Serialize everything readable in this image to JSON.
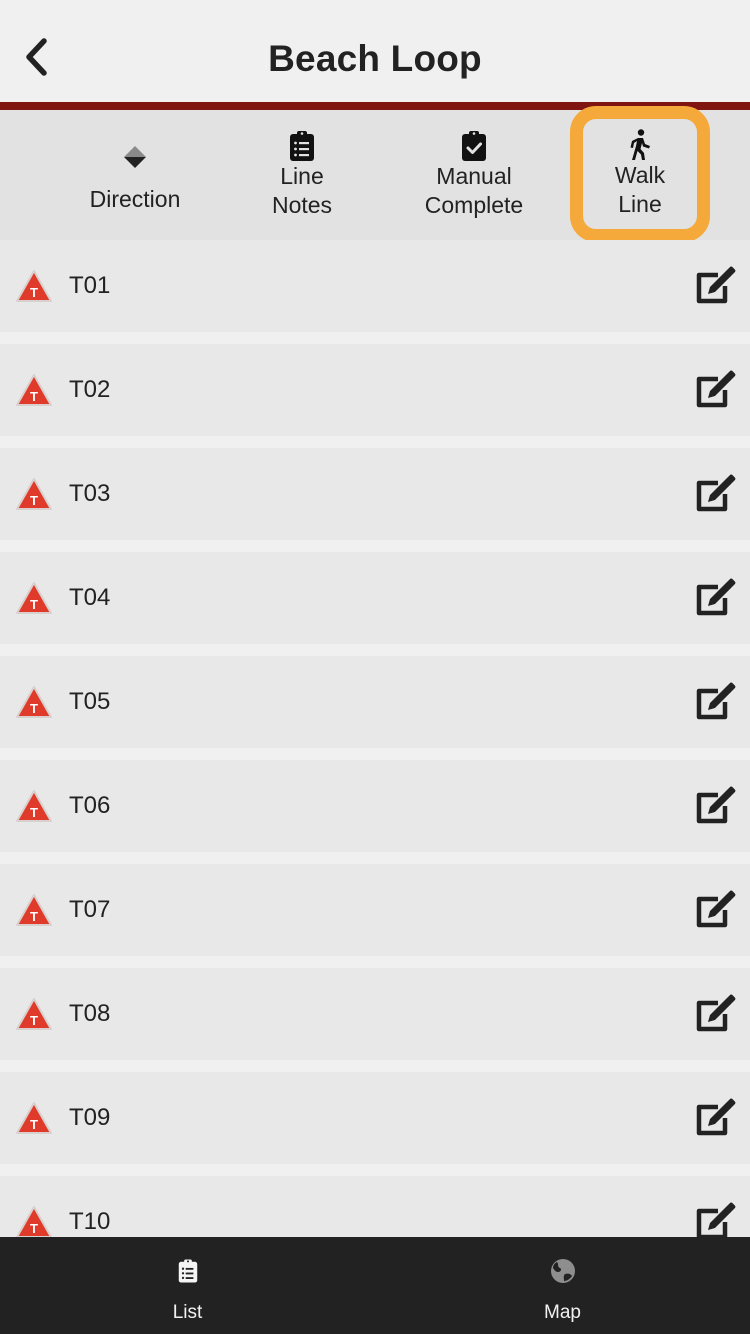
{
  "navbar": {
    "title": "Beach Loop",
    "back_icon": "chevron-left-icon"
  },
  "colors": {
    "accent_bar": "#7f1410",
    "highlight": "#f4a93a",
    "warning": "#e03a2a",
    "tabbar_bg": "#222222"
  },
  "toolbar": {
    "items": [
      {
        "id": "direction",
        "label": "Direction",
        "icon": "direction-diamond-icon"
      },
      {
        "id": "line-notes",
        "label": "Line\nNotes",
        "icon": "clipboard-list-icon"
      },
      {
        "id": "manual-complete",
        "label": "Manual\nComplete",
        "icon": "clipboard-check-icon"
      },
      {
        "id": "walk-line",
        "label": "Walk\nLine",
        "icon": "walking-person-icon",
        "highlighted": true
      }
    ]
  },
  "list": {
    "items": [
      {
        "name": "T01",
        "status_icon": "warning-triangle-icon",
        "action_icon": "edit-icon"
      },
      {
        "name": "T02",
        "status_icon": "warning-triangle-icon",
        "action_icon": "edit-icon"
      },
      {
        "name": "T03",
        "status_icon": "warning-triangle-icon",
        "action_icon": "edit-icon"
      },
      {
        "name": "T04",
        "status_icon": "warning-triangle-icon",
        "action_icon": "edit-icon"
      },
      {
        "name": "T05",
        "status_icon": "warning-triangle-icon",
        "action_icon": "edit-icon"
      },
      {
        "name": "T06",
        "status_icon": "warning-triangle-icon",
        "action_icon": "edit-icon"
      },
      {
        "name": "T07",
        "status_icon": "warning-triangle-icon",
        "action_icon": "edit-icon"
      },
      {
        "name": "T08",
        "status_icon": "warning-triangle-icon",
        "action_icon": "edit-icon"
      },
      {
        "name": "T09",
        "status_icon": "warning-triangle-icon",
        "action_icon": "edit-icon"
      },
      {
        "name": "T10",
        "status_icon": "warning-triangle-icon",
        "action_icon": "edit-icon"
      }
    ]
  },
  "tabbar": {
    "tabs": [
      {
        "label": "List",
        "icon": "clipboard-list-icon",
        "active": true
      },
      {
        "label": "Map",
        "icon": "globe-icon",
        "active": false
      }
    ]
  }
}
